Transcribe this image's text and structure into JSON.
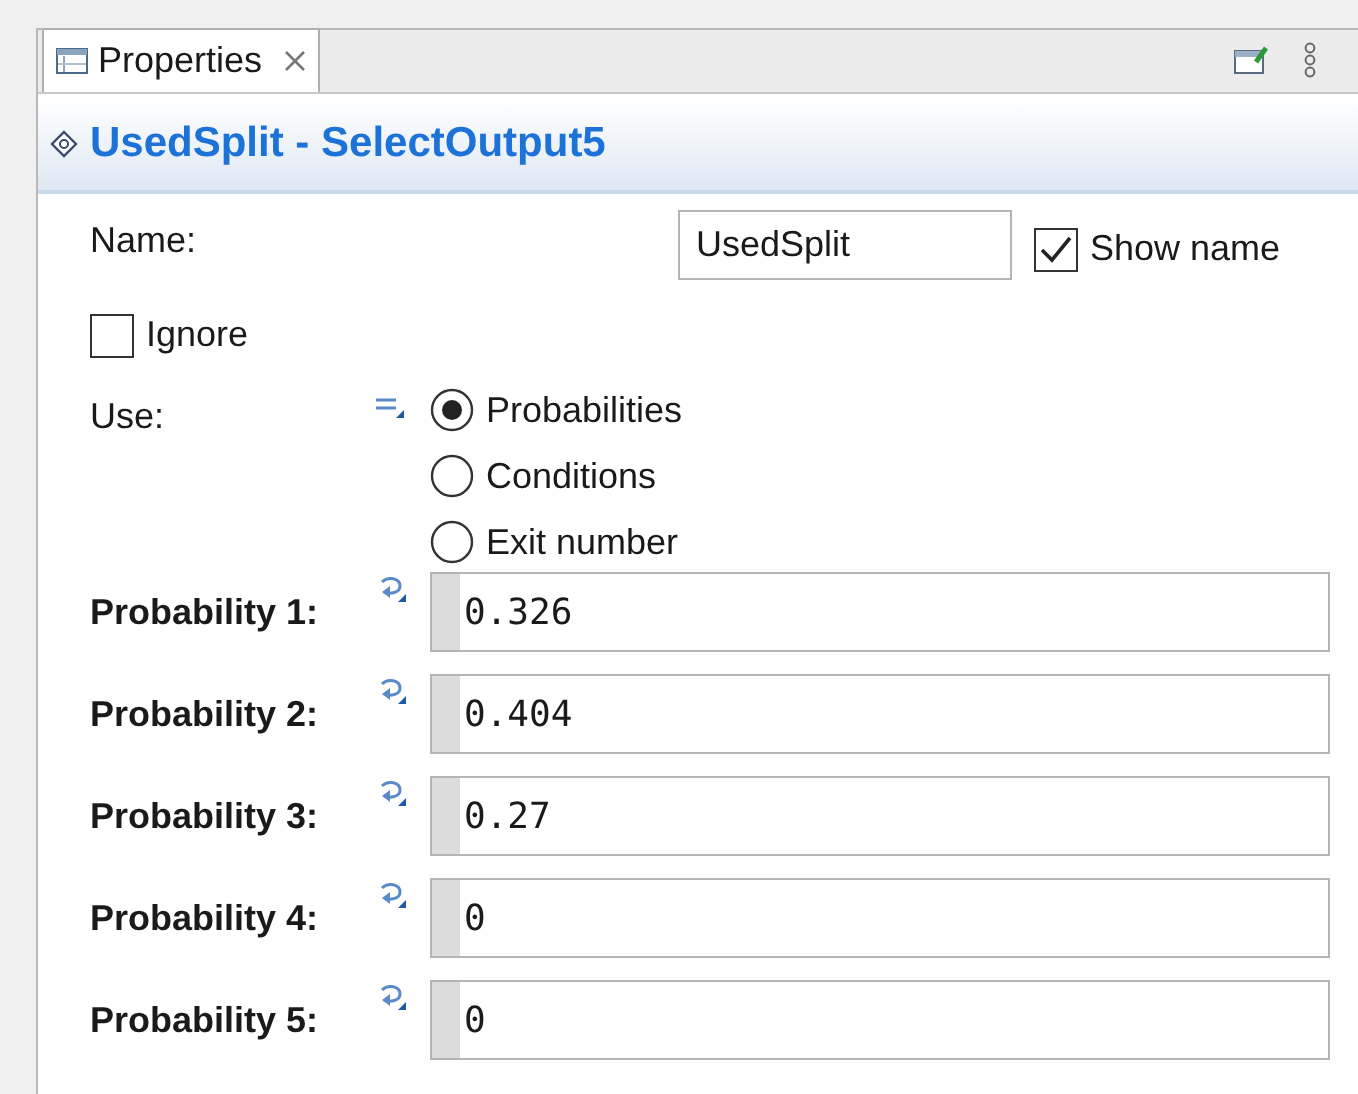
{
  "tab": {
    "label": "Properties",
    "selected": true
  },
  "title": "UsedSplit - SelectOutput5",
  "name_field": {
    "label": "Name:",
    "value": "UsedSplit"
  },
  "show_name": {
    "label": "Show name",
    "checked": true
  },
  "ignore": {
    "label": "Ignore",
    "checked": false
  },
  "use": {
    "label": "Use:",
    "options": [
      {
        "label": "Probabilities",
        "selected": true
      },
      {
        "label": "Conditions",
        "selected": false
      },
      {
        "label": "Exit number",
        "selected": false
      }
    ]
  },
  "probabilities": [
    {
      "label": "Probability 1:",
      "value": "0.326"
    },
    {
      "label": "Probability 2:",
      "value": "0.404"
    },
    {
      "label": "Probability 3:",
      "value": "0.27"
    },
    {
      "label": "Probability 4:",
      "value": "0"
    },
    {
      "label": "Probability 5:",
      "value": "0"
    }
  ]
}
